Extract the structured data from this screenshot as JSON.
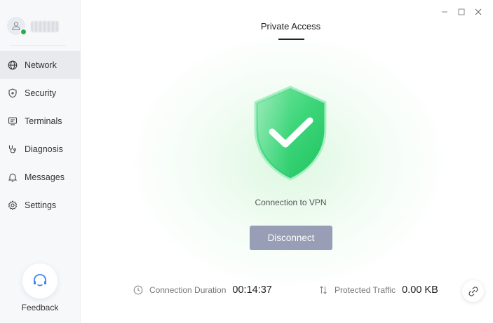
{
  "sidebar": {
    "items": [
      {
        "label": "Network",
        "icon": "globe-icon",
        "active": true
      },
      {
        "label": "Security",
        "icon": "shield-icon",
        "active": false
      },
      {
        "label": "Terminals",
        "icon": "terminals-icon",
        "active": false
      },
      {
        "label": "Diagnosis",
        "icon": "stethoscope-icon",
        "active": false
      },
      {
        "label": "Messages",
        "icon": "bell-icon",
        "active": false
      },
      {
        "label": "Settings",
        "icon": "gear-icon",
        "active": false
      }
    ],
    "feedback_label": "Feedback"
  },
  "main": {
    "tab_title": "Private Access",
    "status_text": "Connection to VPN",
    "disconnect_label": "Disconnect",
    "stats": {
      "duration_label": "Connection Duration",
      "duration_value": "00:14:37",
      "traffic_label": "Protected Traffic",
      "traffic_value": "0.00 KB"
    }
  },
  "colors": {
    "accent_green": "#22c55e",
    "button_gray": "#979eb5",
    "sidebar_bg": "#f7f8fa",
    "active_item_bg": "#e8eaee"
  }
}
